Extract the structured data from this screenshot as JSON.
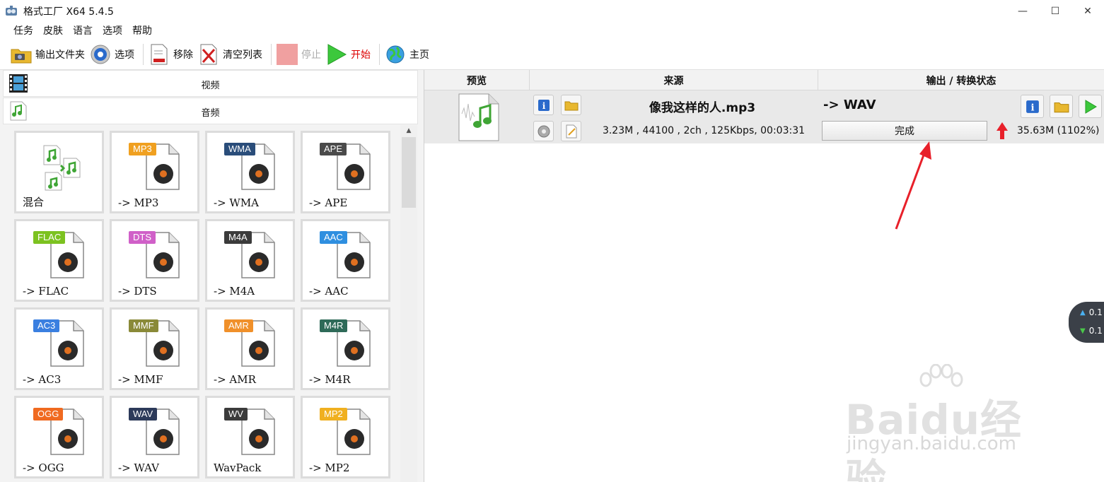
{
  "window": {
    "title": "格式工厂 X64 5.4.5",
    "controls": [
      "—",
      "☐",
      "✕"
    ]
  },
  "menu": [
    "任务",
    "皮肤",
    "语言",
    "选项",
    "帮助"
  ],
  "toolbar": {
    "output_folder": "输出文件夹",
    "options": "选项",
    "remove": "移除",
    "clear_list": "清空列表",
    "stop": "停止",
    "start": "开始",
    "home": "主页"
  },
  "categories": {
    "video": "视频",
    "audio": "音频"
  },
  "formats": [
    {
      "badge": "",
      "label": "混合",
      "color": "#3fa535"
    },
    {
      "badge": "MP3",
      "label": "-> MP3",
      "color": "#f0a020"
    },
    {
      "badge": "WMA",
      "label": "-> WMA",
      "color": "#2a4d7a"
    },
    {
      "badge": "APE",
      "label": "-> APE",
      "color": "#4a4a4a"
    },
    {
      "badge": "FLAC",
      "label": "-> FLAC",
      "color": "#7cc220"
    },
    {
      "badge": "DTS",
      "label": "-> DTS",
      "color": "#d060c8"
    },
    {
      "badge": "M4A",
      "label": "-> M4A",
      "color": "#3b3b3b"
    },
    {
      "badge": "AAC",
      "label": "-> AAC",
      "color": "#2f8fe0"
    },
    {
      "badge": "AC3",
      "label": "-> AC3",
      "color": "#3a7fe0"
    },
    {
      "badge": "MMF",
      "label": "-> MMF",
      "color": "#8a8a38"
    },
    {
      "badge": "AMR",
      "label": "-> AMR",
      "color": "#f0902a"
    },
    {
      "badge": "M4R",
      "label": "-> M4R",
      "color": "#2e6a58"
    },
    {
      "badge": "OGG",
      "label": "-> OGG",
      "color": "#f06a20"
    },
    {
      "badge": "WAV",
      "label": "-> WAV",
      "color": "#2c3a5a"
    },
    {
      "badge": "WV",
      "label": "WavPack",
      "color": "#3b3b3b"
    },
    {
      "badge": "MP2",
      "label": "-> MP2",
      "color": "#f0b020"
    }
  ],
  "table": {
    "headers": {
      "preview": "预览",
      "source": "来源",
      "output": "输出 / 转换状态"
    },
    "task": {
      "filename": "像我这样的人.mp3",
      "info": "3.23M , 44100 , 2ch , 125Kbps, 00:03:31",
      "output_format": "-> WAV",
      "status": "完成",
      "output_size": "35.63M  (1102%)"
    }
  },
  "net_widget": {
    "up": "0.1",
    "down": "0.1"
  },
  "watermark": {
    "logo": "Baidu经验",
    "url": "jingyan.baidu.com"
  },
  "colors": {
    "start_green": "#3cc83c",
    "stop_disabled": "#f0a0a0",
    "annotation_red": "#e8202a"
  }
}
